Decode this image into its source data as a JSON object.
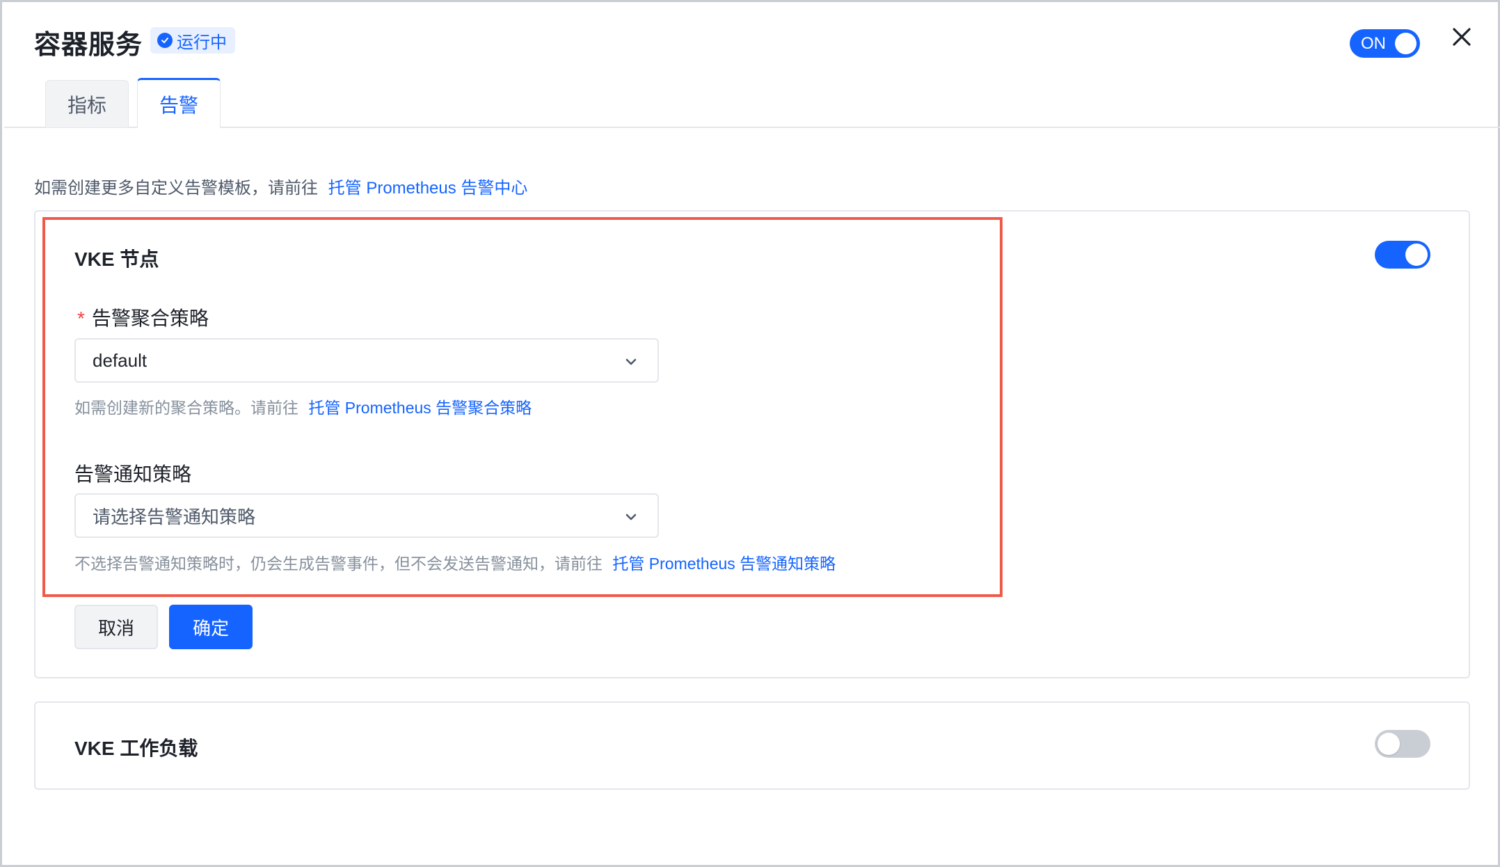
{
  "header": {
    "title": "容器服务",
    "status": "运行中",
    "toggle_label": "ON"
  },
  "tabs": [
    {
      "label": "指标",
      "active": false
    },
    {
      "label": "告警",
      "active": true
    }
  ],
  "info": {
    "text": "如需创建更多自定义告警模板，请前往",
    "link": "托管 Prometheus 告警中心"
  },
  "card_nodes": {
    "title": "VKE 节点",
    "enabled": true,
    "aggregation": {
      "label": "告警聚合策略",
      "required_mark": "*",
      "value": "default",
      "help_text": "如需创建新的聚合策略。请前往",
      "help_link": "托管 Prometheus 告警聚合策略"
    },
    "notification": {
      "label": "告警通知策略",
      "placeholder": "请选择告警通知策略",
      "help_text": "不选择告警通知策略时，仍会生成告警事件，但不会发送告警通知，请前往",
      "help_link": "托管 Prometheus 告警通知策略"
    },
    "cancel_label": "取消",
    "ok_label": "确定"
  },
  "card_workloads": {
    "title": "VKE 工作负载",
    "enabled": false
  },
  "colors": {
    "accent": "#1664ff",
    "highlight": "#f05a4a",
    "required": "#f53f3f"
  }
}
